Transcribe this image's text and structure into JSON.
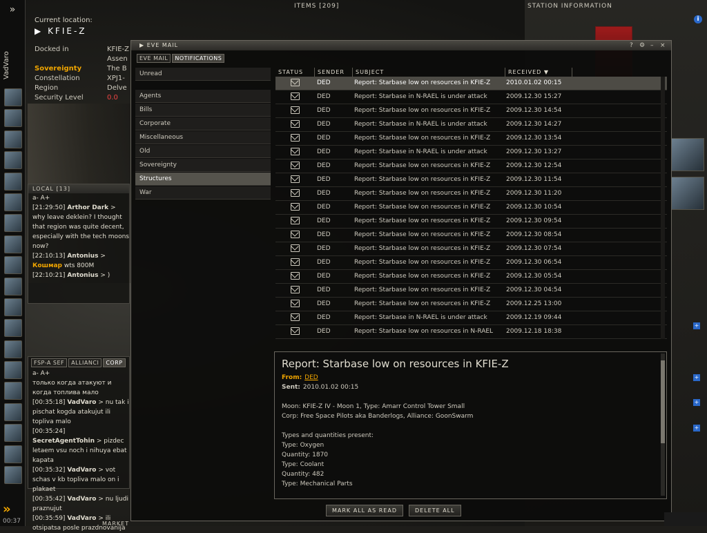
{
  "sidebar": {
    "character_name": "VadVaro",
    "time": "00:37",
    "expand_label": "»"
  },
  "location": {
    "current_label": "Current location:",
    "system": "KFIE-Z",
    "rows": [
      {
        "k": "Docked in",
        "v": "KFIE-Z"
      },
      {
        "k": "",
        "v": "Assen"
      },
      {
        "k": "Sovereignty",
        "v": "The B"
      },
      {
        "k": "Constellation",
        "v": "XPJ1-"
      },
      {
        "k": "Region",
        "v": "Delve"
      },
      {
        "k": "Security Level",
        "v": "0.0"
      }
    ]
  },
  "topbar": {
    "items_label": "ITEMS [209]",
    "station_label": "STATION INFORMATION",
    "info_icon": "i"
  },
  "local": {
    "title": "LOCAL [13]",
    "font_controls": "a-  A+",
    "lines": [
      {
        "time": "[21:29:50]",
        "name": "Arthor Dark",
        "text": " > why leave deklein? I thought that region was quite decent, especially with the tech moons now?"
      },
      {
        "time": "[22:10:13]",
        "name": "Antonius",
        "text": " >",
        "highlight": "Кошмар",
        "after": " wts 800M"
      },
      {
        "time": "[22:10:21]",
        "name": "Antonius",
        "text": " > )"
      }
    ]
  },
  "corp_chat": {
    "tabs": [
      "FSP-A SEF",
      "ALLIANCI",
      "CORP"
    ],
    "font_controls": "a-  A+",
    "lines": [
      {
        "time": "",
        "name": "",
        "text": "только когда атакуют и когда топлива мало"
      },
      {
        "time": "[00:35:18]",
        "name": "VadVaro",
        "text": " > nu tak i pischat kogda atakujut ili topliva malo"
      },
      {
        "time": "[00:35:24]",
        "name": "SecretAgentTohin",
        "text": " > pizdec letaem vsu noch i nihuya ebat kapata"
      },
      {
        "time": "[00:35:32]",
        "name": "VadVaro",
        "text": " > vot schas v kb topliva malo on i plakaet"
      },
      {
        "time": "[00:35:42]",
        "name": "VadVaro",
        "text": " > nu ljudi praznujut"
      },
      {
        "time": "[00:35:59]",
        "name": "VadVaro",
        "text": " > ili otsipatsa posle prazdnovanija"
      }
    ]
  },
  "mail": {
    "title": "EVE MAIL",
    "tabs": [
      "EVE MAIL",
      "NOTIFICATIONS"
    ],
    "folders": [
      {
        "label": "Unread",
        "selected": false
      },
      {
        "label": "Agents",
        "selected": false
      },
      {
        "label": "Bills",
        "selected": false
      },
      {
        "label": "Corporate",
        "selected": false
      },
      {
        "label": "Miscellaneous",
        "selected": false
      },
      {
        "label": "Old",
        "selected": false
      },
      {
        "label": "Sovereignty",
        "selected": false
      },
      {
        "label": "Structures",
        "selected": true
      },
      {
        "label": "War",
        "selected": false
      }
    ],
    "columns": [
      "STATUS",
      "SENDER",
      "SUBJECT",
      "RECEIVED"
    ],
    "rows": [
      {
        "sender": "DED",
        "subject": "Report: Starbase low on resources in KFIE-Z",
        "received": "2010.01.02 00:15"
      },
      {
        "sender": "DED",
        "subject": "Report: Starbase in N-RAEL is under attack",
        "received": "2009.12.30 15:27"
      },
      {
        "sender": "DED",
        "subject": "Report: Starbase low on resources in KFIE-Z",
        "received": "2009.12.30 14:54"
      },
      {
        "sender": "DED",
        "subject": "Report: Starbase in N-RAEL is under attack",
        "received": "2009.12.30 14:27"
      },
      {
        "sender": "DED",
        "subject": "Report: Starbase low on resources in KFIE-Z",
        "received": "2009.12.30 13:54"
      },
      {
        "sender": "DED",
        "subject": "Report: Starbase in N-RAEL is under attack",
        "received": "2009.12.30 13:27"
      },
      {
        "sender": "DED",
        "subject": "Report: Starbase low on resources in KFIE-Z",
        "received": "2009.12.30 12:54"
      },
      {
        "sender": "DED",
        "subject": "Report: Starbase low on resources in KFIE-Z",
        "received": "2009.12.30 11:54"
      },
      {
        "sender": "DED",
        "subject": "Report: Starbase low on resources in KFIE-Z",
        "received": "2009.12.30 11:20"
      },
      {
        "sender": "DED",
        "subject": "Report: Starbase low on resources in KFIE-Z",
        "received": "2009.12.30 10:54"
      },
      {
        "sender": "DED",
        "subject": "Report: Starbase low on resources in KFIE-Z",
        "received": "2009.12.30 09:54"
      },
      {
        "sender": "DED",
        "subject": "Report: Starbase low on resources in KFIE-Z",
        "received": "2009.12.30 08:54"
      },
      {
        "sender": "DED",
        "subject": "Report: Starbase low on resources in KFIE-Z",
        "received": "2009.12.30 07:54"
      },
      {
        "sender": "DED",
        "subject": "Report: Starbase low on resources in KFIE-Z",
        "received": "2009.12.30 06:54"
      },
      {
        "sender": "DED",
        "subject": "Report: Starbase low on resources in KFIE-Z",
        "received": "2009.12.30 05:54"
      },
      {
        "sender": "DED",
        "subject": "Report: Starbase low on resources in KFIE-Z",
        "received": "2009.12.30 04:54"
      },
      {
        "sender": "DED",
        "subject": "Report: Starbase low on resources in KFIE-Z",
        "received": "2009.12.25 13:00"
      },
      {
        "sender": "DED",
        "subject": "Report: Starbase in N-RAEL is under attack",
        "received": "2009.12.19 09:44"
      },
      {
        "sender": "DED",
        "subject": "Report: Starbase low on resources in N-RAEL",
        "received": "2009.12.18 18:38"
      }
    ],
    "preview": {
      "subject": "Report: Starbase low on resources in KFIE-Z",
      "from_label": "From:",
      "from": "DED",
      "sent_label": "Sent:",
      "sent": "2010.01.02 00:15",
      "body": [
        "Moon: KFIE-Z IV - Moon 1, Type: Amarr Control Tower Small",
        "Corp: Free Space Pilots aka Banderlogs, Alliance: GoonSwarm",
        "",
        "Types and quantities present:",
        "Type: Oxygen",
        "Quantity: 1870",
        "Type: Coolant",
        "Quantity: 482",
        "Type: Mechanical Parts"
      ]
    },
    "buttons": {
      "mark_all": "MARK ALL AS READ",
      "delete_all": "DELETE ALL"
    }
  },
  "bottom": {
    "market_label": "MARKET"
  },
  "colors": {
    "accent": "#f0a500",
    "selection": "#4d4b45",
    "info_blue": "#2a68c9"
  }
}
